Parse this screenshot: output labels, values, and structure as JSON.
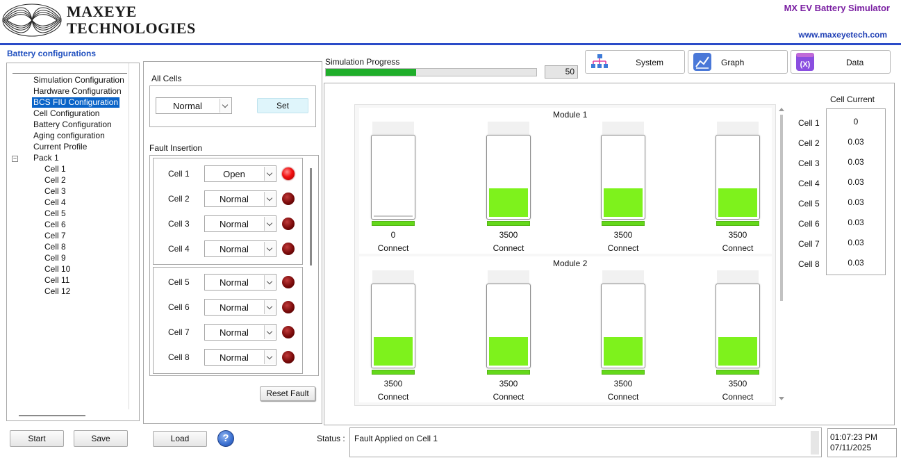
{
  "header": {
    "company_line1": "MAXEYE",
    "company_line2": "TECHNOLOGIES",
    "app_title": "MX EV Battery Simulator",
    "website": "www.maxeyetech.com"
  },
  "section_title": "Battery configurations",
  "tree": {
    "items": [
      {
        "label": "Simulation Configuration",
        "level": 1,
        "selected": false
      },
      {
        "label": "Hardware Configuration",
        "level": 1,
        "selected": false
      },
      {
        "label": "BCS FIU Configuration",
        "level": 1,
        "selected": true
      },
      {
        "label": "Cell Configuration",
        "level": 1,
        "selected": false
      },
      {
        "label": "Battery Configuration",
        "level": 1,
        "selected": false
      },
      {
        "label": "Aging configuration",
        "level": 1,
        "selected": false
      },
      {
        "label": "Current Profile",
        "level": 1,
        "selected": false
      },
      {
        "label": "Pack 1",
        "level": 1,
        "selected": false
      },
      {
        "label": "Cell 1",
        "level": 2,
        "selected": false
      },
      {
        "label": "Cell 2",
        "level": 2,
        "selected": false
      },
      {
        "label": "Cell 3",
        "level": 2,
        "selected": false
      },
      {
        "label": "Cell 4",
        "level": 2,
        "selected": false
      },
      {
        "label": "Cell 5",
        "level": 2,
        "selected": false
      },
      {
        "label": "Cell 6",
        "level": 2,
        "selected": false
      },
      {
        "label": "Cell 7",
        "level": 2,
        "selected": false
      },
      {
        "label": "Cell 8",
        "level": 2,
        "selected": false
      },
      {
        "label": "Cell 9",
        "level": 2,
        "selected": false
      },
      {
        "label": "Cell 10",
        "level": 2,
        "selected": false
      },
      {
        "label": "Cell 11",
        "level": 2,
        "selected": false
      },
      {
        "label": "Cell 12",
        "level": 2,
        "selected": false
      }
    ],
    "expander_symbol": "−"
  },
  "all_cells": {
    "title": "All Cells",
    "selected": "Normal",
    "set_label": "Set"
  },
  "fault_insertion": {
    "title": "Fault Insertion",
    "cells": [
      {
        "label": "Cell 1",
        "value": "Open",
        "led": "on"
      },
      {
        "label": "Cell 2",
        "value": "Normal",
        "led": "off"
      },
      {
        "label": "Cell 3",
        "value": "Normal",
        "led": "off"
      },
      {
        "label": "Cell 4",
        "value": "Normal",
        "led": "off"
      },
      {
        "label": "Cell 5",
        "value": "Normal",
        "led": "off"
      },
      {
        "label": "Cell 6",
        "value": "Normal",
        "led": "off"
      },
      {
        "label": "Cell 7",
        "value": "Normal",
        "led": "off"
      },
      {
        "label": "Cell 8",
        "value": "Normal",
        "led": "off"
      }
    ],
    "reset_label": "Reset Fault"
  },
  "simulation": {
    "progress_label": "Simulation Progress",
    "progress_percent": 0.43,
    "progress_value": "50"
  },
  "nav": {
    "system": "System",
    "graph": "Graph",
    "data": "Data",
    "system_icon": "network-hierarchy-icon",
    "graph_icon": "line-chart-icon",
    "data_icon": "variable-x-icon"
  },
  "modules": [
    {
      "title": "Module 1",
      "cells": [
        {
          "value": "0",
          "status": "Connect",
          "fill": 0.0
        },
        {
          "value": "3500",
          "status": "Connect",
          "fill": 0.35
        },
        {
          "value": "3500",
          "status": "Connect",
          "fill": 0.35
        },
        {
          "value": "3500",
          "status": "Connect",
          "fill": 0.35
        }
      ]
    },
    {
      "title": "Module 2",
      "cells": [
        {
          "value": "3500",
          "status": "Connect",
          "fill": 0.35
        },
        {
          "value": "3500",
          "status": "Connect",
          "fill": 0.35
        },
        {
          "value": "3500",
          "status": "Connect",
          "fill": 0.35
        },
        {
          "value": "3500",
          "status": "Connect",
          "fill": 0.35
        }
      ]
    }
  ],
  "cell_current": {
    "title": "Cell Current",
    "rows": [
      {
        "label": "Cell 1",
        "value": "0"
      },
      {
        "label": "Cell 2",
        "value": "0.03"
      },
      {
        "label": "Cell 3",
        "value": "0.03"
      },
      {
        "label": "Cell 4",
        "value": "0.03"
      },
      {
        "label": "Cell 5",
        "value": "0.03"
      },
      {
        "label": "Cell 6",
        "value": "0.03"
      },
      {
        "label": "Cell 7",
        "value": "0.03"
      },
      {
        "label": "Cell 8",
        "value": "0.03"
      }
    ]
  },
  "buttons": {
    "start": "Start",
    "save": "Save",
    "load": "Load",
    "help": "?"
  },
  "status": {
    "label": "Status :",
    "text": "Fault Applied on Cell 1"
  },
  "clock": {
    "time": "01:07:23 PM",
    "date": "07/11/2025"
  },
  "colors": {
    "brand_purple": "#7a1fa2",
    "accent_blue": "#2b4bc8",
    "battery_green": "#7ef21c",
    "progress_green": "#1fae2a",
    "led_red": "#f21010",
    "selection_blue": "#0a64c8"
  }
}
